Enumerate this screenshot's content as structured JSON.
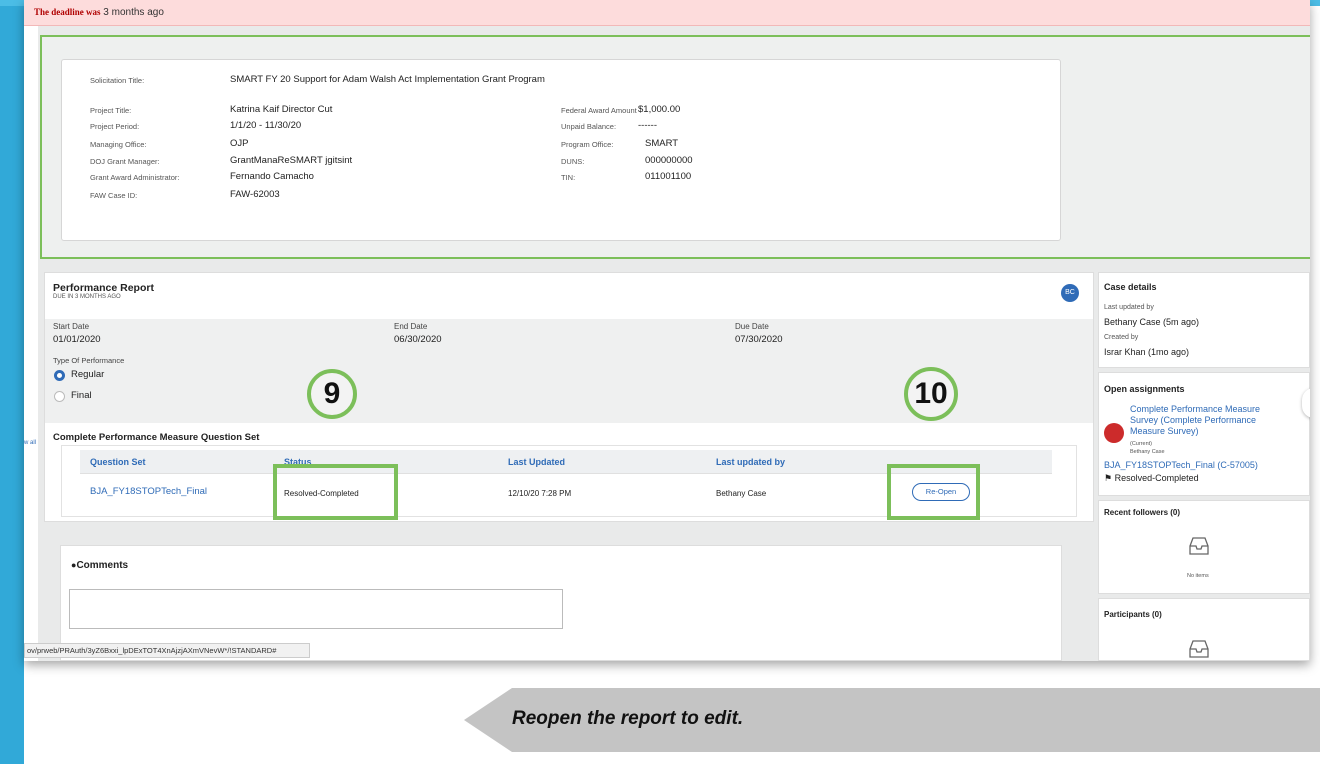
{
  "deadline": {
    "prefix": "The deadline was",
    "value": "3 months ago"
  },
  "info": {
    "solicitation_label": "Solicitation Title:",
    "solicitation_value": "SMART FY 20 Support for Adam Walsh Act Implementation Grant Program",
    "rows_left": [
      {
        "label": "Project Title:",
        "value": "Katrina Kaif Director Cut"
      },
      {
        "label": "Project Period:",
        "value": "1/1/20 - 11/30/20"
      },
      {
        "label": "Managing Office:",
        "value": "OJP"
      },
      {
        "label": "DOJ Grant Manager:",
        "value": "GrantManaReSMART jgitsint"
      },
      {
        "label": "Grant Award Administrator:",
        "value": "Fernando Camacho"
      },
      {
        "label": "FAW Case ID:",
        "value": "FAW-62003"
      }
    ],
    "rows_right": [
      {
        "label": "Federal Award Amount",
        "value": "$1,000.00"
      },
      {
        "label": "Unpaid Balance:",
        "value": "------"
      },
      {
        "label": "Program Office:",
        "value": "SMART"
      },
      {
        "label": "DUNS:",
        "value": "000000000"
      },
      {
        "label": "TIN:",
        "value": "011001100"
      }
    ]
  },
  "report": {
    "title": "Performance Report",
    "subtitle": "DUE IN 3 MONTHS AGO",
    "avatar": "BC",
    "start_label": "Start Date",
    "start_value": "01/01/2020",
    "end_label": "End Date",
    "end_value": "06/30/2020",
    "due_label": "Due Date",
    "due_value": "07/30/2020",
    "type_label": "Type Of Performance",
    "options": [
      "Regular",
      "Final"
    ],
    "selected": "Regular"
  },
  "question_set": {
    "title": "Complete Performance Measure Question Set",
    "headers": [
      "Question Set",
      "Status",
      "Last Updated",
      "Last updated by"
    ],
    "row": {
      "name": "BJA_FY18STOPTech_Final",
      "status": "Resolved-Completed",
      "updated": "12/10/20 7:28 PM",
      "by": "Bethany Case",
      "action": "Re-Open"
    }
  },
  "annotations": {
    "left": "9",
    "right": "10"
  },
  "comments": {
    "title": "Comments"
  },
  "statusbar": "ov/prweb/PRAuth/3yZ6Bxxi_lpDExTOT4XnAjzjAXmVNevW*/!STANDARD#",
  "sidebar": {
    "case_details": "Case details",
    "last_updated_label": "Last updated by",
    "last_updated_value": "Bethany Case (5m ago)",
    "created_label": "Created by",
    "created_value": "Israr Khan (1mo ago)",
    "open_assignments": "Open assignments",
    "assignment_title": "Complete Performance Measure Survey (Complete Performance Measure Survey)",
    "assignment_current": "(Current)",
    "assignment_owner": "Bethany Case",
    "case_link": "BJA_FY18STOPTech_Final (C-57005)",
    "case_status": "Resolved-Completed",
    "recent_followers": "Recent followers (0)",
    "no_items": "No items",
    "participants": "Participants (0)"
  },
  "left_stub": "w all",
  "banner": "Reopen the report to edit.",
  "colors": {
    "accent": "#2f6bb7",
    "highlight": "#7cbf5a",
    "alert_bg": "#fddcdc",
    "urgent": "#cc2b2b"
  }
}
